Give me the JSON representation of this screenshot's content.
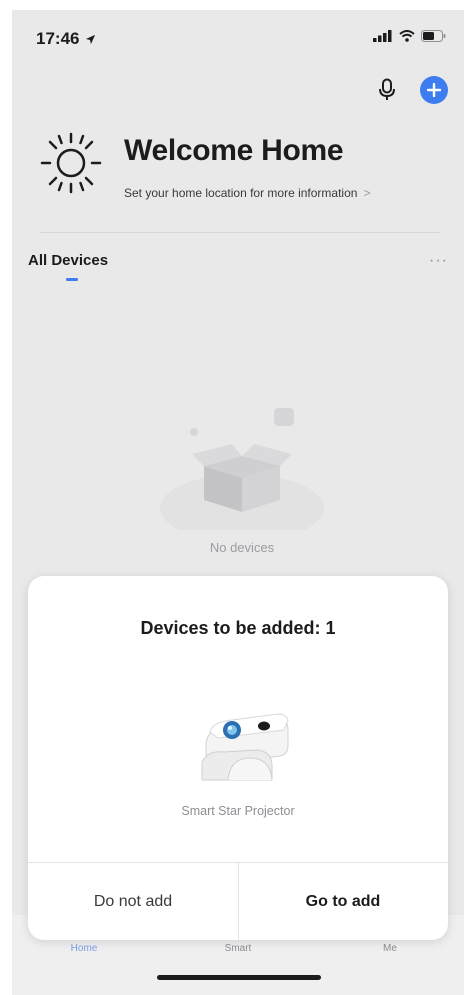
{
  "status": {
    "time": "17:46"
  },
  "welcome": {
    "title": "Welcome Home",
    "subtitle": "Set your home location for more information",
    "chevron": ">"
  },
  "tabs": {
    "all_devices": "All Devices",
    "more": "···"
  },
  "empty": {
    "label": "No devices"
  },
  "nav": {
    "home": "Home",
    "smart": "Smart",
    "me": "Me"
  },
  "modal": {
    "title": "Devices to be added: 1",
    "device_name": "Smart Star Projector",
    "do_not_add": "Do not add",
    "go_to_add": "Go to add"
  },
  "colors": {
    "accent": "#3d7df0",
    "overlay": "#e9e9ea"
  }
}
